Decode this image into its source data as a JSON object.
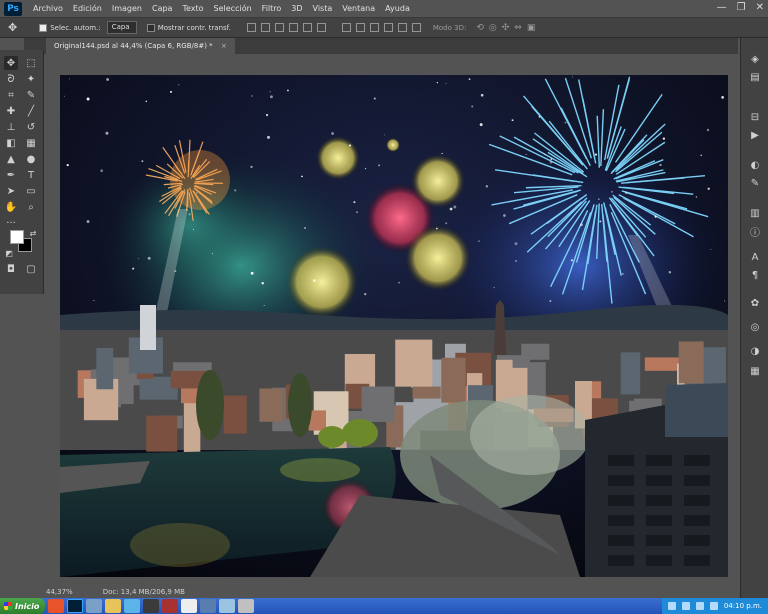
{
  "app": {
    "logo": "Ps"
  },
  "menu": [
    "Archivo",
    "Edición",
    "Imagen",
    "Capa",
    "Texto",
    "Selección",
    "Filtro",
    "3D",
    "Vista",
    "Ventana",
    "Ayuda"
  ],
  "window_controls": {
    "minimize": "—",
    "restore": "❐",
    "close": "✕"
  },
  "options": {
    "auto_select_label": "Selec. autom.:",
    "auto_select_checked": true,
    "target_value": "Capa",
    "show_transform_label": "Mostrar contr. transf.",
    "show_transform_checked": false,
    "mode_3d_label": "Modo 3D:"
  },
  "document_tab": {
    "title": "Original144.psd al 44,4% (Capa 6, RGB/8#) *",
    "close": "×"
  },
  "status": {
    "zoom": "44,37%",
    "doc_info": "Doc: 13,4 MB/206,9 MB"
  },
  "taskbar": {
    "start_label": "Inicio",
    "clock": "04:10 p.m."
  },
  "colors": {
    "foreground": "#ffffff",
    "background": "#000000",
    "ui_dark": "#424242",
    "ui_mid": "#535353"
  }
}
